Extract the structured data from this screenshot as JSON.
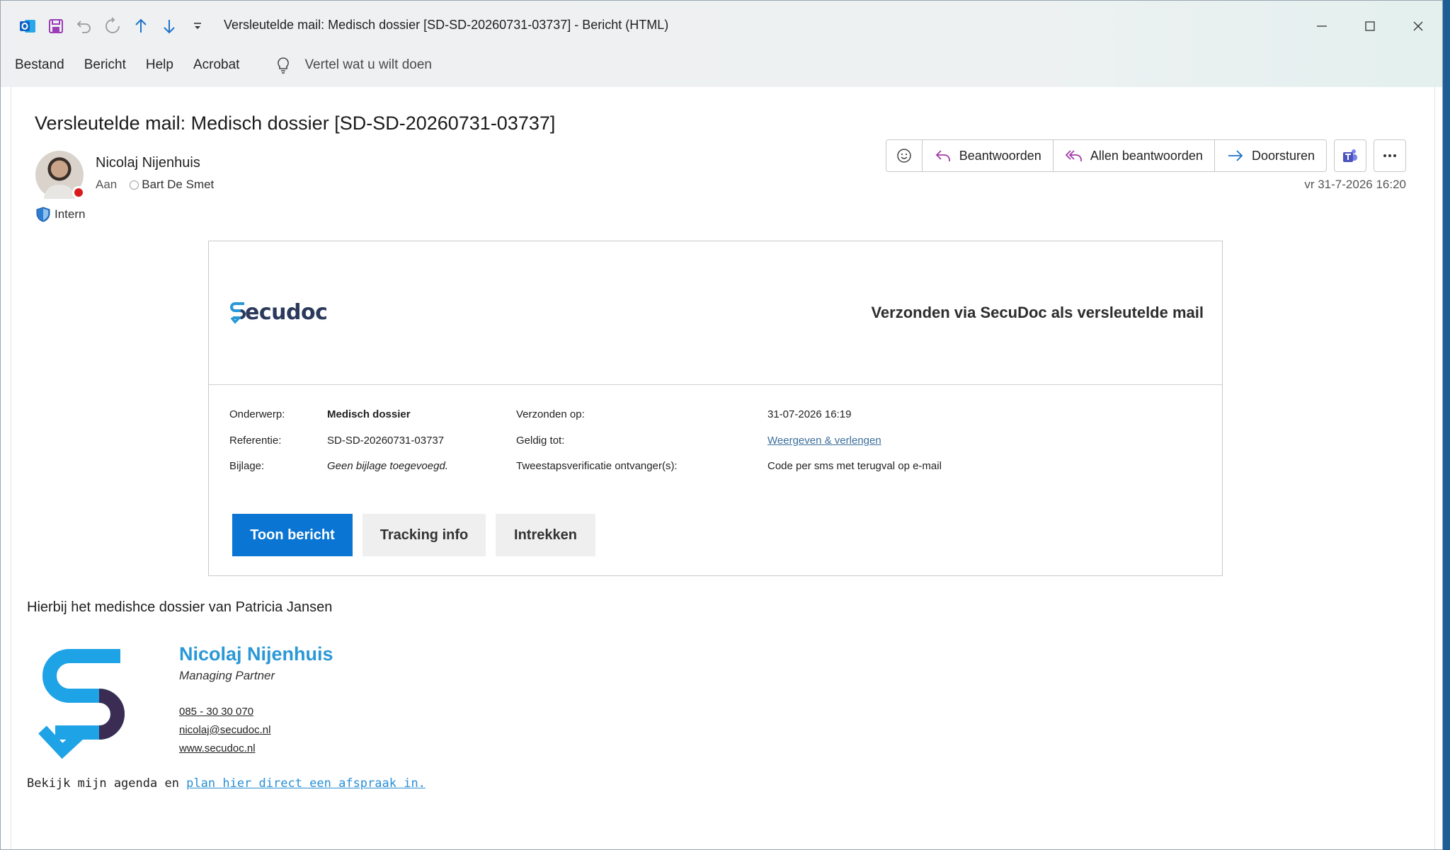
{
  "window": {
    "title": "Versleutelde mail: Medisch dossier [SD-SD-20260731-03737]  -  Bericht (HTML)"
  },
  "menu": [
    "Bestand",
    "Bericht",
    "Help",
    "Acrobat"
  ],
  "tellme": {
    "placeholder": "Vertel wat u wilt doen"
  },
  "message": {
    "subject": "Versleutelde mail: Medisch dossier [SD-SD-20260731-03737]",
    "sender": "Nicolaj Nijenhuis",
    "to_label": "Aan",
    "recipient": "Bart De Smet",
    "sensitivity": "Intern",
    "datetime": "vr 31-7-2026 16:20"
  },
  "actions": {
    "reply": "Beantwoorden",
    "reply_all": "Allen beantwoorden",
    "forward": "Doorsturen"
  },
  "card": {
    "brand": "ecudoc",
    "sent_via": "Verzonden via SecuDoc als versleutelde mail",
    "fields": [
      {
        "label": "Onderwerp:",
        "value": "Medisch dossier",
        "label2": "Verzonden op:",
        "value2": "31-07-2026 16:19"
      },
      {
        "label": "Referentie:",
        "value": "SD-SD-20260731-03737",
        "label2": "Geldig tot:",
        "value2": "Weergeven & verlengen"
      },
      {
        "label": "Bijlage:",
        "value": "Geen bijlage toegevoegd.",
        "label2": "Tweestapsverificatie ontvanger(s):",
        "value2": "Code per sms met terugval op e-mail"
      }
    ],
    "buttons": {
      "show": "Toon bericht",
      "tracking": "Tracking info",
      "revoke": "Intrekken"
    }
  },
  "body": {
    "text": "Hierbij het medishce dossier van Patricia Jansen",
    "signature": {
      "name": "Nicolaj Nijenhuis",
      "role": "Managing Partner",
      "phone": "085 - 30 30 070",
      "email": "nicolaj@secudoc.nl",
      "website": "www.secudoc.nl"
    },
    "agenda_prefix": "Bekijk mijn agenda en ",
    "agenda_link": "plan hier direct een afspraak in."
  },
  "colors": {
    "accent": "#0a75d2",
    "brand_blue": "#2b98d6",
    "brand_dark": "#2b3a5c",
    "presence_busy": "#d91b1b"
  }
}
